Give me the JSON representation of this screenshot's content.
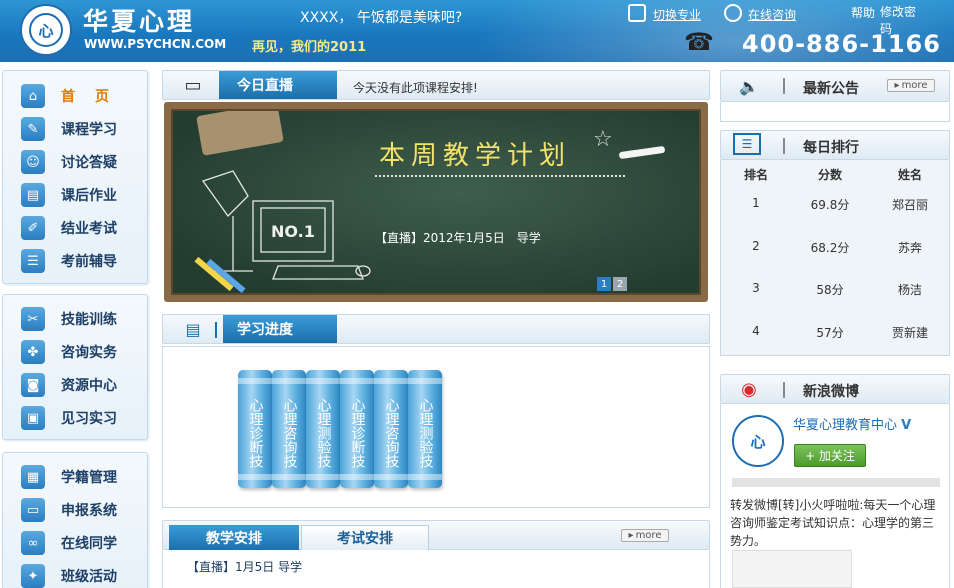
{
  "header": {
    "logo_cn": "华夏心理",
    "logo_en": "WWW.PSYCHCN.COM",
    "greeting": "XXXX， 午饭都是美味吧?",
    "farewell": "再见，我们的2011",
    "switch_major": "切换专业",
    "online_consult": "在线咨询",
    "help": "帮助",
    "change_pwd": "修改密码",
    "hotline": "400-886-1166"
  },
  "sidebar": {
    "group1": [
      "首页",
      "课程学习",
      "讨论答疑",
      "课后作业",
      "结业考试",
      "考前辅导"
    ],
    "group2": [
      "技能训练",
      "咨询实务",
      "资源中心",
      "见习实习"
    ],
    "group3": [
      "学籍管理",
      "申报系统",
      "在线同学",
      "班级活动"
    ]
  },
  "live": {
    "title": "今日直播",
    "notice": "今天没有此项课程安排!",
    "board_title": "本周教学计划",
    "board_text": "【直播】2012年1月5日　导学",
    "pages": [
      "1",
      "2"
    ]
  },
  "progress": {
    "title": "学习进度",
    "books": [
      "心理诊断技",
      "心理咨询技",
      "心理测验技",
      "心理诊断技",
      "心理咨询技",
      "心理测验技"
    ]
  },
  "schedule": {
    "tabs": [
      "教学安排",
      "考试安排"
    ],
    "more": "more",
    "item": "【直播】1月5日 导学"
  },
  "notice_panel": {
    "title": "最新公告",
    "more": "more"
  },
  "ranking": {
    "title": "每日排行",
    "headers": [
      "排名",
      "分数",
      "姓名"
    ],
    "rows": [
      {
        "rank": "1",
        "score": "69.8分",
        "name": "郑召丽"
      },
      {
        "rank": "2",
        "score": "68.2分",
        "name": "苏奔"
      },
      {
        "rank": "3",
        "score": "58分",
        "name": "杨洁"
      },
      {
        "rank": "4",
        "score": "57分",
        "name": "贾新建"
      }
    ]
  },
  "weibo": {
    "title": "新浪微博",
    "account": "华夏心理教育中心",
    "follow": "+ 加关注",
    "post": "转发微博[转]小火呼啦啦:每天一个心理咨询师鉴定考试知识点：心理学的第三势力。"
  }
}
